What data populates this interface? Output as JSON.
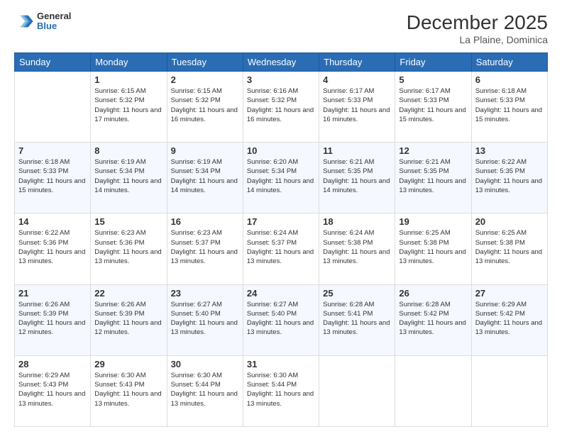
{
  "header": {
    "logo": {
      "general": "General",
      "blue": "Blue"
    },
    "title": "December 2025",
    "location": "La Plaine, Dominica"
  },
  "weekdays": [
    "Sunday",
    "Monday",
    "Tuesday",
    "Wednesday",
    "Thursday",
    "Friday",
    "Saturday"
  ],
  "weeks": [
    [
      {
        "day": "",
        "sunrise": "",
        "sunset": "",
        "daylight": ""
      },
      {
        "day": "1",
        "sunrise": "Sunrise: 6:15 AM",
        "sunset": "Sunset: 5:32 PM",
        "daylight": "Daylight: 11 hours and 17 minutes."
      },
      {
        "day": "2",
        "sunrise": "Sunrise: 6:15 AM",
        "sunset": "Sunset: 5:32 PM",
        "daylight": "Daylight: 11 hours and 16 minutes."
      },
      {
        "day": "3",
        "sunrise": "Sunrise: 6:16 AM",
        "sunset": "Sunset: 5:32 PM",
        "daylight": "Daylight: 11 hours and 16 minutes."
      },
      {
        "day": "4",
        "sunrise": "Sunrise: 6:17 AM",
        "sunset": "Sunset: 5:33 PM",
        "daylight": "Daylight: 11 hours and 16 minutes."
      },
      {
        "day": "5",
        "sunrise": "Sunrise: 6:17 AM",
        "sunset": "Sunset: 5:33 PM",
        "daylight": "Daylight: 11 hours and 15 minutes."
      },
      {
        "day": "6",
        "sunrise": "Sunrise: 6:18 AM",
        "sunset": "Sunset: 5:33 PM",
        "daylight": "Daylight: 11 hours and 15 minutes."
      }
    ],
    [
      {
        "day": "7",
        "sunrise": "Sunrise: 6:18 AM",
        "sunset": "Sunset: 5:33 PM",
        "daylight": "Daylight: 11 hours and 15 minutes."
      },
      {
        "day": "8",
        "sunrise": "Sunrise: 6:19 AM",
        "sunset": "Sunset: 5:34 PM",
        "daylight": "Daylight: 11 hours and 14 minutes."
      },
      {
        "day": "9",
        "sunrise": "Sunrise: 6:19 AM",
        "sunset": "Sunset: 5:34 PM",
        "daylight": "Daylight: 11 hours and 14 minutes."
      },
      {
        "day": "10",
        "sunrise": "Sunrise: 6:20 AM",
        "sunset": "Sunset: 5:34 PM",
        "daylight": "Daylight: 11 hours and 14 minutes."
      },
      {
        "day": "11",
        "sunrise": "Sunrise: 6:21 AM",
        "sunset": "Sunset: 5:35 PM",
        "daylight": "Daylight: 11 hours and 14 minutes."
      },
      {
        "day": "12",
        "sunrise": "Sunrise: 6:21 AM",
        "sunset": "Sunset: 5:35 PM",
        "daylight": "Daylight: 11 hours and 13 minutes."
      },
      {
        "day": "13",
        "sunrise": "Sunrise: 6:22 AM",
        "sunset": "Sunset: 5:35 PM",
        "daylight": "Daylight: 11 hours and 13 minutes."
      }
    ],
    [
      {
        "day": "14",
        "sunrise": "Sunrise: 6:22 AM",
        "sunset": "Sunset: 5:36 PM",
        "daylight": "Daylight: 11 hours and 13 minutes."
      },
      {
        "day": "15",
        "sunrise": "Sunrise: 6:23 AM",
        "sunset": "Sunset: 5:36 PM",
        "daylight": "Daylight: 11 hours and 13 minutes."
      },
      {
        "day": "16",
        "sunrise": "Sunrise: 6:23 AM",
        "sunset": "Sunset: 5:37 PM",
        "daylight": "Daylight: 11 hours and 13 minutes."
      },
      {
        "day": "17",
        "sunrise": "Sunrise: 6:24 AM",
        "sunset": "Sunset: 5:37 PM",
        "daylight": "Daylight: 11 hours and 13 minutes."
      },
      {
        "day": "18",
        "sunrise": "Sunrise: 6:24 AM",
        "sunset": "Sunset: 5:38 PM",
        "daylight": "Daylight: 11 hours and 13 minutes."
      },
      {
        "day": "19",
        "sunrise": "Sunrise: 6:25 AM",
        "sunset": "Sunset: 5:38 PM",
        "daylight": "Daylight: 11 hours and 13 minutes."
      },
      {
        "day": "20",
        "sunrise": "Sunrise: 6:25 AM",
        "sunset": "Sunset: 5:38 PM",
        "daylight": "Daylight: 11 hours and 13 minutes."
      }
    ],
    [
      {
        "day": "21",
        "sunrise": "Sunrise: 6:26 AM",
        "sunset": "Sunset: 5:39 PM",
        "daylight": "Daylight: 11 hours and 12 minutes."
      },
      {
        "day": "22",
        "sunrise": "Sunrise: 6:26 AM",
        "sunset": "Sunset: 5:39 PM",
        "daylight": "Daylight: 11 hours and 12 minutes."
      },
      {
        "day": "23",
        "sunrise": "Sunrise: 6:27 AM",
        "sunset": "Sunset: 5:40 PM",
        "daylight": "Daylight: 11 hours and 13 minutes."
      },
      {
        "day": "24",
        "sunrise": "Sunrise: 6:27 AM",
        "sunset": "Sunset: 5:40 PM",
        "daylight": "Daylight: 11 hours and 13 minutes."
      },
      {
        "day": "25",
        "sunrise": "Sunrise: 6:28 AM",
        "sunset": "Sunset: 5:41 PM",
        "daylight": "Daylight: 11 hours and 13 minutes."
      },
      {
        "day": "26",
        "sunrise": "Sunrise: 6:28 AM",
        "sunset": "Sunset: 5:42 PM",
        "daylight": "Daylight: 11 hours and 13 minutes."
      },
      {
        "day": "27",
        "sunrise": "Sunrise: 6:29 AM",
        "sunset": "Sunset: 5:42 PM",
        "daylight": "Daylight: 11 hours and 13 minutes."
      }
    ],
    [
      {
        "day": "28",
        "sunrise": "Sunrise: 6:29 AM",
        "sunset": "Sunset: 5:43 PM",
        "daylight": "Daylight: 11 hours and 13 minutes."
      },
      {
        "day": "29",
        "sunrise": "Sunrise: 6:30 AM",
        "sunset": "Sunset: 5:43 PM",
        "daylight": "Daylight: 11 hours and 13 minutes."
      },
      {
        "day": "30",
        "sunrise": "Sunrise: 6:30 AM",
        "sunset": "Sunset: 5:44 PM",
        "daylight": "Daylight: 11 hours and 13 minutes."
      },
      {
        "day": "31",
        "sunrise": "Sunrise: 6:30 AM",
        "sunset": "Sunset: 5:44 PM",
        "daylight": "Daylight: 11 hours and 13 minutes."
      },
      {
        "day": "",
        "sunrise": "",
        "sunset": "",
        "daylight": ""
      },
      {
        "day": "",
        "sunrise": "",
        "sunset": "",
        "daylight": ""
      },
      {
        "day": "",
        "sunrise": "",
        "sunset": "",
        "daylight": ""
      }
    ]
  ]
}
